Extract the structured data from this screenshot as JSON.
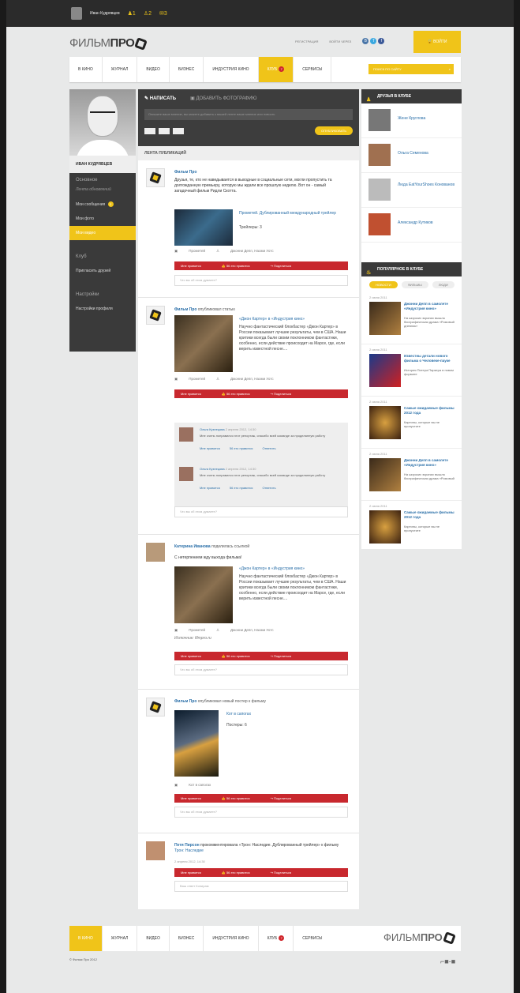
{
  "topbar": {
    "user_name": "Иван Кудрявцев",
    "counts": [
      "1",
      "2",
      "3"
    ]
  },
  "header": {
    "logo_light": "ФИЛЬМ",
    "logo_bold": "ПРО",
    "register": "РЕГИСТРАЦИЯ",
    "login_via": "ВОЙТИ ЧЕРЕЗ",
    "login_button": "ВОЙТИ",
    "social": [
      "В",
      "Т",
      "f"
    ]
  },
  "nav": {
    "items": [
      "В КИНО",
      "ЖУРНАЛ",
      "ВИДЕО",
      "БИЗНЕС",
      "ИНДУСТРИЯ КИНО",
      "КЛУБ",
      "СЕРВИСЫ"
    ],
    "club_badge": "7",
    "search_placeholder": "ПОИСК ПО САЙТУ"
  },
  "profile": {
    "name": "ИВАН КУДРЯВЦЕВ",
    "basic": "Основное",
    "basic_sub": "Лента обновлений",
    "messages": "Мои сообщения",
    "messages_badge": "2",
    "photos": "Мои фото",
    "videos": "Мои видео",
    "club": "Клуб",
    "invite": "Пригласить друзей",
    "settings": "Настройки",
    "profile_settings": "Настройки профиля"
  },
  "compose": {
    "write": "НАПИСАТЬ",
    "add_photo": "ДОБАВИТЬ ФОТОГРАФИЮ",
    "placeholder": "Опишите ваше мнение, вы можете добавить к вашей ленте ваше мнение или новость",
    "publish": "ОПУБЛИКОВАТЬ"
  },
  "feed_title": "ЛЕНТА ПУБЛИКАЦИЙ",
  "actions": {
    "like": "Мне нравится",
    "count_like": "56 это нравится",
    "share": "Поделиться"
  },
  "comment_placeholder": "Что вы об этом думаете?",
  "comment_placeholder_alt": "Ваш ответ Копирам",
  "posts": [
    {
      "author": "Фильм Про",
      "text": "Друзья, те, кто не наведывается в выходные в социальные сети, могли пропустить та долгожданную премьеру, которую мы ждали все прошлую неделю. Вот он - самый загадочный фильм Ридли Скотта.",
      "link": "Прометей. Дублированный международный трейлер",
      "trailers": "Трейлеры: 3",
      "meta_film": "Прометей",
      "meta_people": "Джонни Депп, Наоми Уотс"
    },
    {
      "author": "Фильм Про",
      "action": "опубликовал статью",
      "link": "«Джон Картер» в «Индустрия кино»",
      "text": "Научно фантастический блокбастер «Джон Картер» в России показывает лучшие результаты, чем в США. Наши критики всегда были своим поклонником фантастики, особенно, если действие происходит на Марсе, где, если верить известной песне....",
      "meta_film": "Прометей",
      "meta_people": "Джонни Депп, Наоми Уотс"
    },
    {
      "author": "Катерина Иванова",
      "action": "поделилась ссылкой",
      "quote": "С нетерпением жду выхода фильма!",
      "link": "«Джон Картер» в «Индустрия кино»",
      "text": "Научно фантастический блокбастер «Джон Картер» в России показывает лучшие результаты, чем в США. Наши критики всегда были своим поклонником фантастики, особенно, если действие происходит на Марсе, где, если верить известной песне....",
      "meta_film": "Прометей",
      "meta_people": "Джонни Депп, Наоми Уотс",
      "source": "Источник: filmpro.ru"
    },
    {
      "author": "Фильм Про",
      "action": "опубликовал новый постер к фильму",
      "link": "Кот в сапогах",
      "posters": "Постеры: 6",
      "meta_film": "Кот в сапогах"
    },
    {
      "author": "Петя Пирсон",
      "action": "прокомментировала «Трон: Наследие. Дублированный трейлер» к фильму",
      "film": "Трон: Наследие",
      "date": "2 апреля 2012, 14:30"
    }
  ],
  "replies": [
    {
      "name": "Ольга Кузнецова",
      "date": "2 апреля 2012, 14:30",
      "text": "Мне очень понравился этот репортаж, спасибо всей команде за проделанную работу",
      "like": "Мне нравится",
      "count": "56 это нравится",
      "answer": "Ответить"
    },
    {
      "name": "Ольга Кузнецова",
      "date": "2 апреля 2012, 14:30",
      "text": "Мне очень понравился этот репортаж, спасибо всей команде за проделанную работу",
      "like": "Мне нравится",
      "count": "56 это нравится",
      "answer": "Ответить"
    }
  ],
  "friends": {
    "title": "ДРУЗЬЯ В КЛУБЕ",
    "list": [
      "Жене Круглова",
      "Ольга Семенова",
      "Люда EatYourShoes Конованов",
      "Александр Кутиков"
    ]
  },
  "popular": {
    "title": "ПОПУЛЯРНОЕ В КЛУБЕ",
    "tabs": [
      "НОВОСТИ",
      "ФИЛЬМЫ",
      "ЛЮДИ"
    ],
    "items": [
      {
        "date": "2 июня 2011",
        "title": "Джонни Депп в самолете «Индустрия кино»",
        "desc": "На широких экранах вышла биографическая драма «Ромовый дневник»"
      },
      {
        "date": "2 июня 2011",
        "title": "Известны детали нового фильма о Человеке-пауке",
        "desc": "История Питера Паркера в новом формате"
      },
      {
        "date": "2 июня 2011",
        "title": "Самые ожидаемые фильмы 2012 года",
        "desc": "Картины, которые вы не пропустите"
      },
      {
        "date": "2 июня 2011",
        "title": "Джонни Депп в самолете «Индустрия кино»",
        "desc": "На широких экранах вышла биографическая драма «Ромовый"
      },
      {
        "date": "2 июня 2011",
        "title": "Самые ожидаемые фильмы 2012 года",
        "desc": "Картины, которые вы не пропустите"
      }
    ]
  },
  "footer": {
    "items": [
      "В КИНО",
      "ЖУРНАЛ",
      "ВИДЕО",
      "БИЗНЕС",
      "ИНДУСТРИЯ КИНО",
      "КЛУБ",
      "СЕРВИСЫ"
    ],
    "club_badge": "7",
    "copyright": "© Фильм Про 2012"
  },
  "colors": {
    "accent": "#f0c419",
    "action": "#c8282e",
    "link": "#2a6fa8",
    "dark": "#3a3a3a"
  }
}
